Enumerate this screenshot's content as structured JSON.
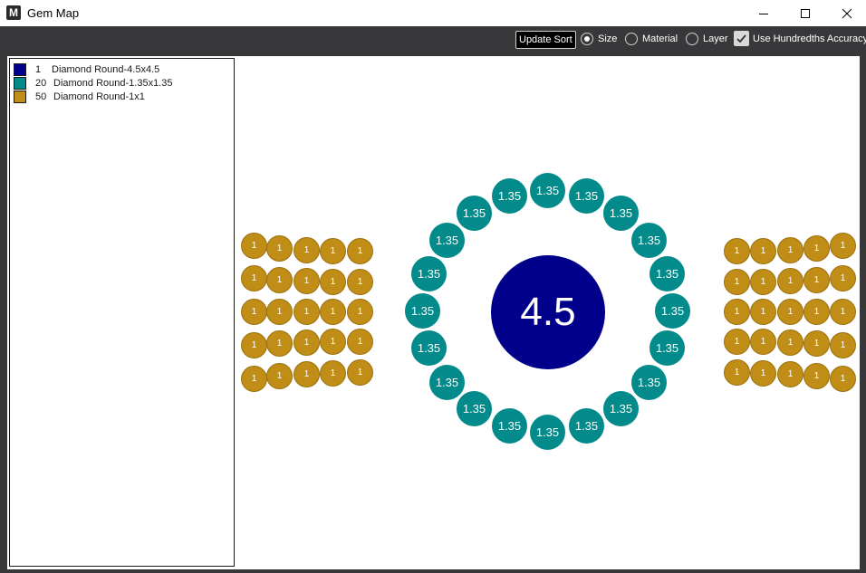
{
  "window": {
    "title": "Gem Map",
    "app_icon_letter": "M",
    "controls": [
      "minimize-icon",
      "maximize-icon",
      "close-icon"
    ]
  },
  "toolbar": {
    "update_sort_label": "Update Sort",
    "sort_options": [
      {
        "label": "Size",
        "checked": true
      },
      {
        "label": "Material",
        "checked": false
      },
      {
        "label": "Layer",
        "checked": false
      }
    ],
    "hundredths_label": "Use Hundredths Accuracy",
    "hundredths_checked": true
  },
  "legend": {
    "items": [
      {
        "count": "1",
        "name": "Diamond Round-4.5x4.5",
        "color": "#00008b"
      },
      {
        "count": "20",
        "name": "Diamond Round-1.35x1.35",
        "color": "#038a8a"
      },
      {
        "count": "50",
        "name": "Diamond Round-1x1",
        "color": "#c08d17"
      }
    ]
  },
  "gem_labels": {
    "center": "4.5",
    "ring": "1.35",
    "side": "1"
  },
  "colors": {
    "center_gem": "#00008b",
    "ring_gem": "#038a8a",
    "side_gem": "#c08d17",
    "frame": "#38383b"
  }
}
